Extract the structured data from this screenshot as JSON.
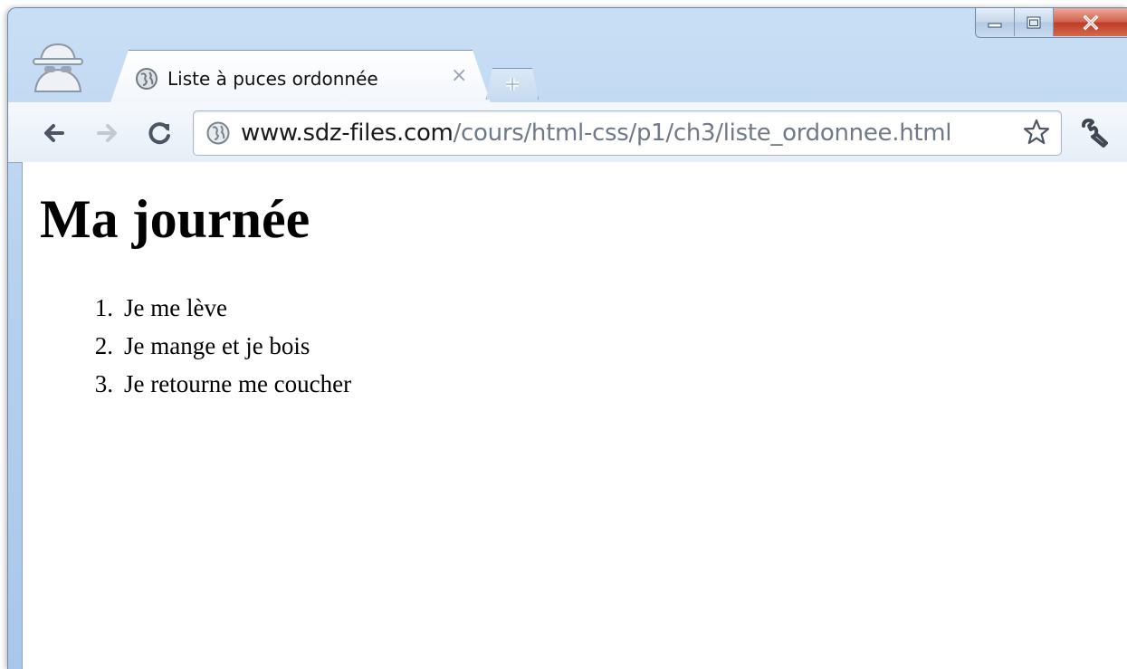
{
  "window": {
    "controls": {
      "minimize_icon": "minimize-icon",
      "maximize_icon": "maximize-icon",
      "close_icon": "close-icon"
    }
  },
  "tab": {
    "title": "Liste à puces ordonnée",
    "favicon": "globe-icon",
    "close_label": "×"
  },
  "toolbar": {
    "back_icon": "back-arrow-icon",
    "forward_icon": "forward-arrow-icon",
    "reload_icon": "reload-icon",
    "url_host": "www.sdz-files.com",
    "url_path": "/cours/html-css/p1/ch3/liste_ordonnee.html",
    "bookmark_icon": "star-icon",
    "settings_icon": "wrench-icon"
  },
  "page": {
    "heading": "Ma journée",
    "list": [
      {
        "num": "1.",
        "text": "Je me lève"
      },
      {
        "num": "2.",
        "text": "Je mange et je bois"
      },
      {
        "num": "3.",
        "text": "Je retourne me coucher"
      }
    ]
  },
  "colors": {
    "frame": "#b7d1ee",
    "close_button": "#c74a33",
    "url_path": "#6f7a86"
  }
}
